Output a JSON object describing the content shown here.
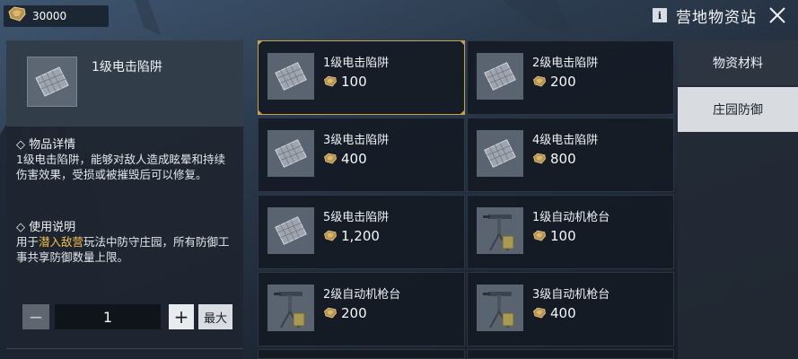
{
  "currency": {
    "amount": "30000",
    "icon": "gem-icon",
    "color": "#c9a25a"
  },
  "header": {
    "info_label": "i",
    "title": "营地物资站",
    "close_icon": "close-icon"
  },
  "detail": {
    "item_name": "1级电击陷阱",
    "section1_title": "◇ 物品详情",
    "section1_body": "1级电击陷阱，能够对敌人造成眩晕和持续伤害效果，受损或被摧毁后可以修复。",
    "section2_title": "◇ 使用说明",
    "section2_prefix": "用于",
    "section2_highlight": "潜入敌营",
    "section2_suffix": "玩法中防守庄园，所有防御工事共享防御数量上限。",
    "quantity": "1",
    "minus_label": "−",
    "plus_label": "+",
    "max_label": "最大"
  },
  "items": [
    {
      "name": "1级电击陷阱",
      "price": "100",
      "type": "trap",
      "selected": true
    },
    {
      "name": "2级电击陷阱",
      "price": "200",
      "type": "trap",
      "selected": false
    },
    {
      "name": "3级电击陷阱",
      "price": "400",
      "type": "trap",
      "selected": false
    },
    {
      "name": "4级电击陷阱",
      "price": "800",
      "type": "trap",
      "selected": false
    },
    {
      "name": "5级电击陷阱",
      "price": "1,200",
      "type": "trap",
      "selected": false
    },
    {
      "name": "1级自动机枪台",
      "price": "100",
      "type": "turret",
      "selected": false
    },
    {
      "name": "2级自动机枪台",
      "price": "200",
      "type": "turret",
      "selected": false
    },
    {
      "name": "3级自动机枪台",
      "price": "400",
      "type": "turret",
      "selected": false
    }
  ],
  "tabs": [
    {
      "label": "物资材料",
      "active": false
    },
    {
      "label": "庄园防御",
      "active": true
    }
  ],
  "colors": {
    "selected_border": "#c8a24a",
    "highlight": "#f2c14b",
    "active_tab": "#d8dce1"
  }
}
